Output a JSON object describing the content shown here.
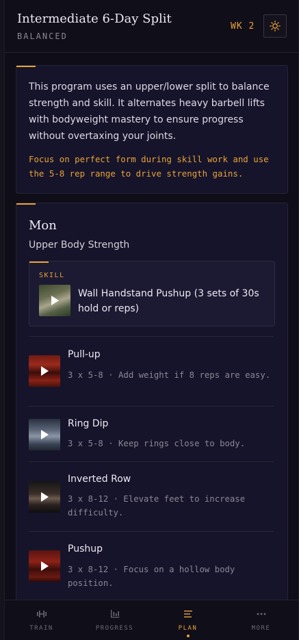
{
  "header": {
    "title": "Intermediate 6-Day Split",
    "subtitle": "BALANCED",
    "week": "WK 2",
    "theme_icon": "sun-icon",
    "accent_color": "#e8a23b"
  },
  "intro": {
    "description": "This program uses an upper/lower split to balance strength and skill. It alternates heavy barbell lifts with bodyweight mastery to ensure progress without overtaxing your joints.",
    "focus": "Focus on perfect form during skill work and use the 5-8 rep range to drive strength gains."
  },
  "day": {
    "name": "Mon",
    "focus": "Upper Body Strength",
    "skill": {
      "label": "SKILL",
      "name": "Wall Handstand Pushup (3 sets of 30s hold or reps)"
    },
    "exercises": [
      {
        "name": "Pull-up",
        "detail": "3 x 5-8 · Add weight if 8 reps are easy."
      },
      {
        "name": "Ring Dip",
        "detail": "3 x 5-8 · Keep rings close to body."
      },
      {
        "name": "Inverted Row",
        "detail": "3 x 8-12 · Elevate feet to increase difficulty."
      },
      {
        "name": "Pushup",
        "detail": "3 x 8-12 · Focus on a hollow body position."
      }
    ]
  },
  "nav": {
    "items": [
      {
        "label": "TRAIN",
        "icon": "dumbbell-icon"
      },
      {
        "label": "PROGRESS",
        "icon": "bar-chart-icon"
      },
      {
        "label": "PLAN",
        "icon": "list-icon"
      },
      {
        "label": "MORE",
        "icon": "more-dots-icon"
      }
    ],
    "active": "PLAN"
  }
}
